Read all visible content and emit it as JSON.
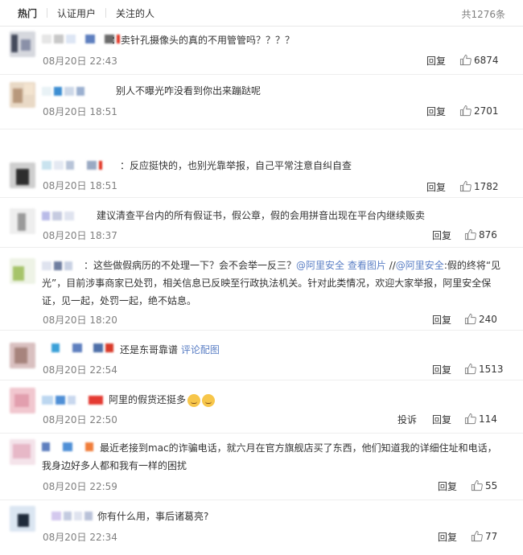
{
  "tabs": [
    {
      "label": "热门",
      "active": true
    },
    {
      "label": "认证用户",
      "active": false
    },
    {
      "label": "关注的人",
      "active": false
    }
  ],
  "total": "共1276条",
  "reply_label": "回复",
  "report_label": "投诉",
  "comments": [
    {
      "text": "：卖针孔摄像头的真的不用管管吗？？？？",
      "time": "08月20日 22:43",
      "likes": "6874"
    },
    {
      "text": "别人不曝光咋没看到你出来蹦跶呢",
      "time": "08月20日 18:51",
      "likes": "2701"
    },
    {
      "text": "：反应挺快的，也别光靠举报，自己平常注意自纠自查",
      "time": "08月20日 18:51",
      "likes": "1782"
    },
    {
      "text": "建议清查平台内的所有假证书，假公章，假的会用拼音出现在平台内继续贩卖",
      "time": "08月20日 18:37",
      "likes": "876"
    },
    {
      "text_a": "：这些做假病历的不处理一下？会不会举一反三？",
      "link_a": "@阿里安全",
      "link_b": "查看图片",
      "text_b": "//",
      "link_c": "@阿里安全",
      "text_c": ":假的终将“见光",
      "text_d": "”，目前涉事商家已处罚，相关信息已反映至行政执法机关。针对此类情况，欢迎大家举报，阿里安全保证，见一起，处罚一起，绝不姑息。",
      "time": "08月20日 18:20",
      "likes": "240"
    },
    {
      "text": "还是东哥靠谱",
      "link": "评论配图",
      "time": "08月20日 22:54",
      "likes": "1513"
    },
    {
      "text": "阿里的假货还挺多",
      "time": "08月20日 22:50",
      "likes": "114"
    },
    {
      "text": "最近老接到mac的诈骗电话，就六月在官方旗舰店买了东西，他们知道我的详细住址和电话，我身边好多人都和我有一样的困扰",
      "time": "08月20日 22:59",
      "likes": "55"
    },
    {
      "text": "你有什么用，事后诸葛亮?",
      "time": "08月20日 22:34",
      "likes": "77"
    }
  ]
}
